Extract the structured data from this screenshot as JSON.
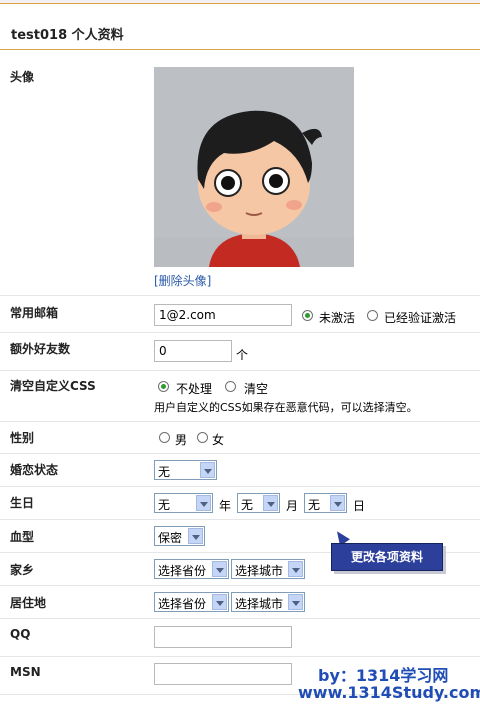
{
  "page": {
    "title": "test018 个人资料"
  },
  "avatar": {
    "label": "头像",
    "delete_link": "[删除头像]"
  },
  "email": {
    "label": "常用邮箱",
    "value": "1@2.com",
    "options": [
      "未激活",
      "已经验证激活"
    ],
    "selected": "未激活"
  },
  "extra_friends": {
    "label": "额外好友数",
    "value": "0",
    "unit": "个"
  },
  "clear_css": {
    "label": "清空自定义CSS",
    "options": [
      "不处理",
      "清空"
    ],
    "selected": "不处理",
    "hint": "用户自定义的CSS如果存在恶意代码，可以选择清空。"
  },
  "gender": {
    "label": "性别",
    "options": [
      "男",
      "女"
    ]
  },
  "marital": {
    "label": "婚恋状态",
    "value": "无"
  },
  "birthday": {
    "label": "生日",
    "year": "无",
    "year_unit": "年",
    "month": "无",
    "month_unit": "月",
    "day": "无",
    "day_unit": "日"
  },
  "blood": {
    "label": "血型",
    "value": "保密"
  },
  "hometown": {
    "label": "家乡",
    "province": "选择省份",
    "city": "选择城市"
  },
  "residence": {
    "label": "居住地",
    "province": "选择省份",
    "city": "选择城市"
  },
  "qq": {
    "label": "QQ",
    "value": ""
  },
  "msn": {
    "label": "MSN",
    "value": ""
  },
  "callout": {
    "text": "更改各项资料"
  },
  "watermark": {
    "line1": "by：1314学习网",
    "line2": "www.1314Study.com"
  },
  "colors": {
    "title_rule": "#d9a34b",
    "link": "#2a5aa8",
    "callout_bg": "#2c3f9b",
    "watermark": "#1f4db5",
    "radio_on": "#2f9a2f"
  }
}
